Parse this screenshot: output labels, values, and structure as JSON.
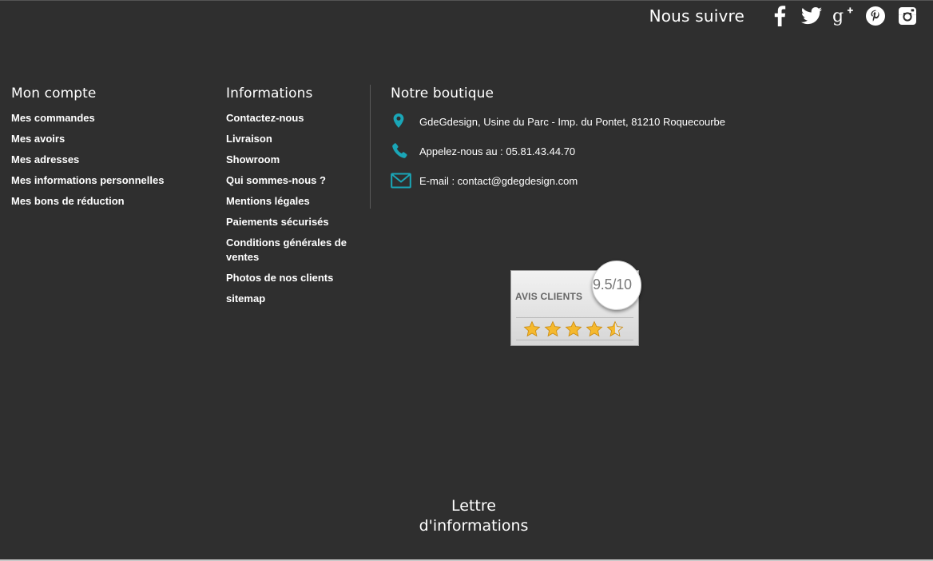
{
  "social": {
    "title": "Nous suivre",
    "icons": [
      "facebook-icon",
      "twitter-icon",
      "google-plus-icon",
      "pinterest-icon",
      "instagram-icon"
    ]
  },
  "account": {
    "title": "Mon compte",
    "links": [
      "Mes commandes",
      "Mes avoirs",
      "Mes adresses",
      "Mes informations personnelles",
      "Mes bons de réduction"
    ]
  },
  "informations": {
    "title": "Informations",
    "links": [
      "Contactez-nous",
      "Livraison",
      "Showroom",
      "Qui sommes-nous ?",
      "Mentions légales",
      "Paiements sécurisés",
      "Conditions générales de ventes",
      "Photos de nos clients",
      "sitemap"
    ]
  },
  "store": {
    "title": "Notre boutique",
    "address": "GdeGdesign, Usine du Parc - Imp. du Pontet, 81210 Roquecourbe",
    "phone": "Appelez-nous au : 05.81.43.44.70",
    "email": "E-mail : contact@gdegdesign.com",
    "icons": [
      "location-pin-icon",
      "phone-icon",
      "envelope-icon"
    ],
    "accent_color": "#1aa6b7"
  },
  "reviews": {
    "label": "AVIS CLIENTS",
    "score": "9.5/10",
    "rating": 4.5,
    "max_stars": 5
  },
  "newsletter": {
    "title_line1": "Lettre",
    "title_line2": "d'informations"
  }
}
